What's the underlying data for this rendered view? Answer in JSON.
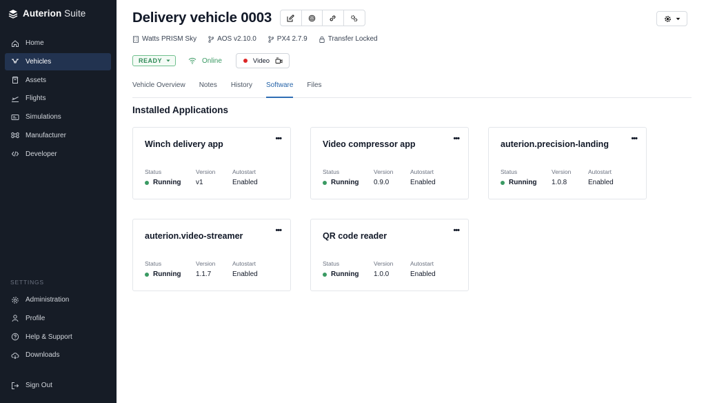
{
  "brand": {
    "name_bold": "Auterion",
    "name_light": " Suite"
  },
  "nav": {
    "items": [
      {
        "label": "Home",
        "icon": "home-icon"
      },
      {
        "label": "Vehicles",
        "icon": "drone-icon",
        "active": true
      },
      {
        "label": "Assets",
        "icon": "box-icon"
      },
      {
        "label": "Flights",
        "icon": "flight-icon"
      },
      {
        "label": "Simulations",
        "icon": "simulation-icon"
      },
      {
        "label": "Manufacturer",
        "icon": "command-icon"
      },
      {
        "label": "Developer",
        "icon": "code-icon"
      }
    ],
    "settings_label": "SETTINGS",
    "settings_items": [
      {
        "label": "Administration",
        "icon": "gear-icon"
      },
      {
        "label": "Profile",
        "icon": "user-icon"
      },
      {
        "label": "Help & Support",
        "icon": "help-icon"
      },
      {
        "label": "Downloads",
        "icon": "cloud-download-icon"
      }
    ],
    "sign_out": "Sign Out"
  },
  "vehicle": {
    "title": "Delivery vehicle 0003",
    "model": "Watts PRISM Sky",
    "aos": "AOS v2.10.0",
    "px4": "PX4 2.7.9",
    "transfer": "Transfer Locked",
    "status": "READY",
    "connection": "Online",
    "video_label": "Video"
  },
  "tabs": [
    {
      "label": "Vehicle Overview"
    },
    {
      "label": "Notes"
    },
    {
      "label": "History"
    },
    {
      "label": "Software",
      "active": true
    },
    {
      "label": "Files"
    }
  ],
  "section_title": "Installed Applications",
  "labels": {
    "status": "Status",
    "version": "Version",
    "autostart": "Autostart"
  },
  "apps": [
    {
      "name": "Winch delivery app",
      "status": "Running",
      "version": "v1",
      "autostart": "Enabled"
    },
    {
      "name": "Video compressor app",
      "status": "Running",
      "version": "0.9.0",
      "autostart": "Enabled"
    },
    {
      "name": "auterion.precision-landing",
      "status": "Running",
      "version": "1.0.8",
      "autostart": "Enabled"
    },
    {
      "name": "auterion.video-streamer",
      "status": "Running",
      "version": "1.1.7",
      "autostart": "Enabled"
    },
    {
      "name": "QR code reader",
      "status": "Running",
      "version": "1.0.0",
      "autostart": "Enabled"
    }
  ],
  "colors": {
    "sidebar_bg": "#161c26",
    "active_nav": "#223350",
    "accent": "#2e6db4",
    "status_green": "#3a9a63",
    "record_red": "#dc2626"
  }
}
